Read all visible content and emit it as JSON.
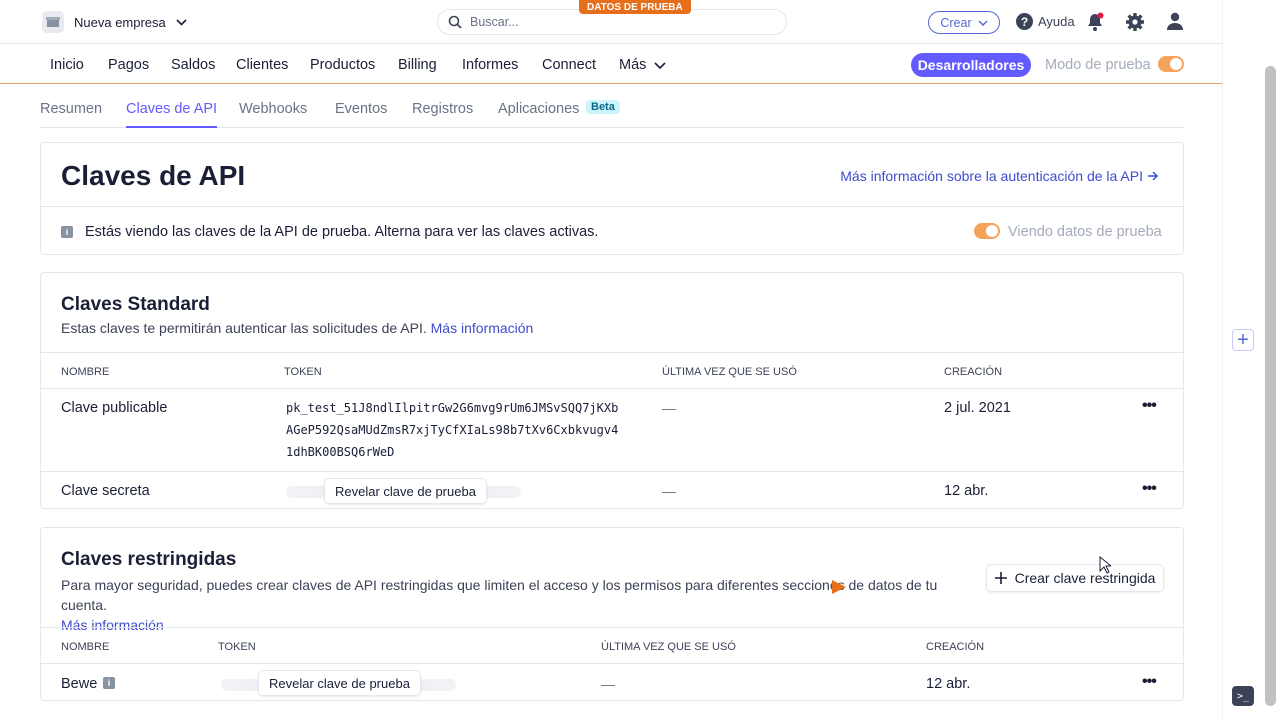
{
  "topbar": {
    "company": "Nueva empresa",
    "search_placeholder": "Buscar...",
    "create_label": "Crear",
    "help_label": "Ayuda"
  },
  "nav": {
    "items": [
      "Inicio",
      "Pagos",
      "Saldos",
      "Clientes",
      "Productos",
      "Billing",
      "Informes",
      "Connect",
      "Más"
    ],
    "developers": "Desarrolladores",
    "test_mode": "Modo de prueba"
  },
  "subtabs": {
    "items": [
      "Resumen",
      "Claves de API",
      "Webhooks",
      "Eventos",
      "Registros",
      "Aplicaciones"
    ],
    "active": "Claves de API",
    "test_badge": "DATOS DE PRUEBA",
    "beta": "Beta"
  },
  "header": {
    "title": "Claves de API",
    "more_link": "Más información sobre la autenticación de la API",
    "info_text": "Estás viendo las claves de la API de prueba. Alterna para ver las claves activas.",
    "viewing_label": "Viendo datos de prueba"
  },
  "standard": {
    "title": "Claves Standard",
    "desc": "Estas claves te permitirán autenticar las solicitudes de API.",
    "desc_link": "Más información",
    "columns": [
      "NOMBRE",
      "TOKEN",
      "ÚLTIMA VEZ QUE SE USÓ",
      "CREACIÓN"
    ],
    "rows": [
      {
        "name": "Clave publicable",
        "token_lines": [
          "pk_test_51J8ndlIlpitrGw2G6mvg9rUm6JMSvSQQ7jKXb",
          "AGeP592QsaMUdZmsR7xjTyCfXIaLs98b7tXv6Cxbkvugv4",
          "1dhBK00BSQ6rWeD"
        ],
        "last_used": "—",
        "created": "2 jul. 2021"
      },
      {
        "name": "Clave secreta",
        "reveal": "Revelar clave de prueba",
        "last_used": "—",
        "created": "12 abr."
      }
    ]
  },
  "restricted": {
    "title": "Claves restringidas",
    "desc": "Para mayor seguridad, puedes crear claves de API restringidas que limiten el acceso y los permisos para diferentes secciones de datos de tu cuenta.",
    "desc_link": "Más información",
    "create_btn": "Crear clave restringida",
    "columns": [
      "NOMBRE",
      "TOKEN",
      "ÚLTIMA VEZ QUE SE USÓ",
      "CREACIÓN"
    ],
    "rows": [
      {
        "name": "Bewe",
        "reveal": "Revelar clave de prueba",
        "last_used": "—",
        "created": "12 abr."
      }
    ]
  },
  "colors": {
    "accent": "#635bff",
    "test_orange": "#e56f1b",
    "link": "#3f4bd0"
  }
}
